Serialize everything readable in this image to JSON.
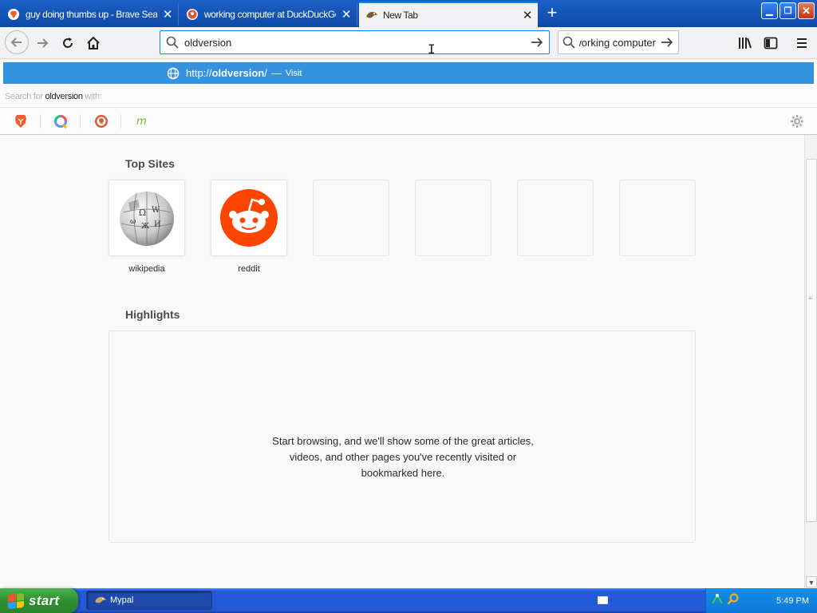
{
  "tabs": [
    {
      "title": "guy doing thumbs up - Brave Search",
      "icon": "brave-icon",
      "color": "#e8542e"
    },
    {
      "title": "working computer at DuckDuckGo",
      "icon": "duckduckgo-icon",
      "color": "#de5833"
    },
    {
      "title": "New Tab",
      "icon": "mypal-icon",
      "active": true
    }
  ],
  "toolbar": {
    "url_value": "oldversion",
    "search_value": "working computer"
  },
  "dropdown": {
    "suggestion_prefix": "http://",
    "suggestion_bold": "oldversion",
    "suggestion_suffix": "/",
    "suggestion_dash": "—",
    "suggestion_action": "Visit",
    "search_for_prefix": "Search for ",
    "search_for_query": "oldversion",
    "search_for_suffix": " with:",
    "engines": [
      "brave",
      "qwant",
      "duckduckgo",
      "mojeek"
    ],
    "highlight_color": "#3592df"
  },
  "newtab": {
    "top_sites_title": "Top Sites",
    "top_sites": [
      {
        "label": "wikipedia",
        "icon": "wikipedia-icon"
      },
      {
        "label": "reddit",
        "icon": "reddit-icon"
      },
      {
        "label": ""
      },
      {
        "label": ""
      },
      {
        "label": ""
      },
      {
        "label": ""
      }
    ],
    "highlights_title": "Highlights",
    "highlights_lines": [
      "Start browsing, and we'll show some of the great articles,",
      "videos, and other pages you've recently visited or",
      "bookmarked here."
    ]
  },
  "taskbar": {
    "start_label": "start",
    "app_label": "Mypal",
    "clock": "5:49 PM"
  }
}
